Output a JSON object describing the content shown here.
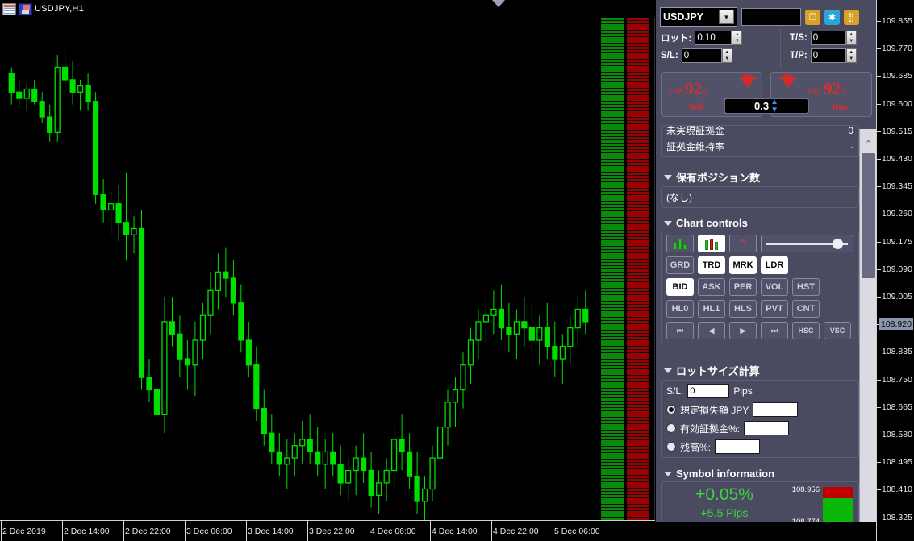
{
  "chart_window": {
    "title": "USDJPY,H1",
    "icons": [
      "window-icon",
      "save-icon"
    ]
  },
  "chart_data": {
    "type": "candlestick",
    "title": "USDJPY,H1",
    "symbol": "USDJPY",
    "timeframe": "H1",
    "xlabel": "",
    "ylabel": "",
    "ylim": [
      108.28,
      109.9
    ],
    "current_price": "108.920",
    "grid": false,
    "legend": null,
    "price_ticks": [
      "109.855",
      "109.770",
      "109.685",
      "109.600",
      "109.515",
      "109.430",
      "109.345",
      "109.260",
      "109.175",
      "109.090",
      "109.005",
      "108.920",
      "108.835",
      "108.750",
      "108.665",
      "108.580",
      "108.495",
      "108.410",
      "108.325"
    ],
    "time_ticks": [
      "2 Dec 2019",
      "2 Dec 14:00",
      "2 Dec 22:00",
      "3 Dec 06:00",
      "3 Dec 14:00",
      "3 Dec 22:00",
      "4 Dec 06:00",
      "4 Dec 14:00",
      "4 Dec 22:00",
      "5 Dec 06:00"
    ],
    "candle_color": "#00e000",
    "background": "#000000",
    "ohlc": [
      [
        109.72,
        109.74,
        109.62,
        109.66
      ],
      [
        109.66,
        109.7,
        109.61,
        109.64
      ],
      [
        109.64,
        109.69,
        109.6,
        109.67
      ],
      [
        109.67,
        109.7,
        109.62,
        109.63
      ],
      [
        109.63,
        109.66,
        109.56,
        109.58
      ],
      [
        109.58,
        109.62,
        109.5,
        109.53
      ],
      [
        109.53,
        109.78,
        109.5,
        109.74
      ],
      [
        109.74,
        109.8,
        109.66,
        109.7
      ],
      [
        109.7,
        109.76,
        109.62,
        109.66
      ],
      [
        109.66,
        109.7,
        109.6,
        109.68
      ],
      [
        109.68,
        109.72,
        109.6,
        109.63
      ],
      [
        109.63,
        109.66,
        109.3,
        109.33
      ],
      [
        109.33,
        109.38,
        109.24,
        109.28
      ],
      [
        109.28,
        109.34,
        109.2,
        109.3
      ],
      [
        109.3,
        109.36,
        109.18,
        109.24
      ],
      [
        109.24,
        109.4,
        109.12,
        109.2
      ],
      [
        109.2,
        109.26,
        109.14,
        109.22
      ],
      [
        109.22,
        109.28,
        108.7,
        108.74
      ],
      [
        108.74,
        108.8,
        108.66,
        108.7
      ],
      [
        108.7,
        108.76,
        108.58,
        108.62
      ],
      [
        108.62,
        109.0,
        108.56,
        108.92
      ],
      [
        108.92,
        109.0,
        108.84,
        108.88
      ],
      [
        108.88,
        108.94,
        108.74,
        108.8
      ],
      [
        108.8,
        108.86,
        108.7,
        108.78
      ],
      [
        108.78,
        108.92,
        108.68,
        108.86
      ],
      [
        108.86,
        108.98,
        108.8,
        108.94
      ],
      [
        108.94,
        109.08,
        108.88,
        109.02
      ],
      [
        109.02,
        109.14,
        108.96,
        109.08
      ],
      [
        109.08,
        109.16,
        109.0,
        109.06
      ],
      [
        109.06,
        109.12,
        108.94,
        108.98
      ],
      [
        108.98,
        109.04,
        108.82,
        108.86
      ],
      [
        108.86,
        108.92,
        108.74,
        108.78
      ],
      [
        108.78,
        108.84,
        108.6,
        108.64
      ],
      [
        108.64,
        108.7,
        108.52,
        108.56
      ],
      [
        108.56,
        108.62,
        108.46,
        108.5
      ],
      [
        108.5,
        108.56,
        108.42,
        108.46
      ],
      [
        108.46,
        108.54,
        108.38,
        108.48
      ],
      [
        108.48,
        108.56,
        108.42,
        108.52
      ],
      [
        108.52,
        108.6,
        108.46,
        108.54
      ],
      [
        108.54,
        108.62,
        108.46,
        108.5
      ],
      [
        108.5,
        108.58,
        108.42,
        108.46
      ],
      [
        108.46,
        108.54,
        108.38,
        108.5
      ],
      [
        108.5,
        108.56,
        108.42,
        108.46
      ],
      [
        108.46,
        108.52,
        108.36,
        108.4
      ],
      [
        108.4,
        108.48,
        108.34,
        108.44
      ],
      [
        108.44,
        108.52,
        108.36,
        108.48
      ],
      [
        108.48,
        108.56,
        108.4,
        108.44
      ],
      [
        108.44,
        108.5,
        108.32,
        108.36
      ],
      [
        108.36,
        108.44,
        108.3,
        108.4
      ],
      [
        108.4,
        108.48,
        108.34,
        108.44
      ],
      [
        108.44,
        108.58,
        108.38,
        108.54
      ],
      [
        108.54,
        108.62,
        108.44,
        108.5
      ],
      [
        108.5,
        108.56,
        108.38,
        108.42
      ],
      [
        108.42,
        108.5,
        108.3,
        108.34
      ],
      [
        108.34,
        108.42,
        108.28,
        108.38
      ],
      [
        108.38,
        108.52,
        108.34,
        108.48
      ],
      [
        108.48,
        108.62,
        108.42,
        108.58
      ],
      [
        108.58,
        108.7,
        108.52,
        108.66
      ],
      [
        108.66,
        108.74,
        108.58,
        108.7
      ],
      [
        108.7,
        108.82,
        108.64,
        108.78
      ],
      [
        108.78,
        108.9,
        108.72,
        108.86
      ],
      [
        108.86,
        108.96,
        108.8,
        108.92
      ],
      [
        108.92,
        109.0,
        108.84,
        108.94
      ],
      [
        108.94,
        109.02,
        108.88,
        108.96
      ],
      [
        108.96,
        109.04,
        108.86,
        108.9
      ],
      [
        108.9,
        108.98,
        108.82,
        108.88
      ],
      [
        108.88,
        108.96,
        108.8,
        108.92
      ],
      [
        108.92,
        109.0,
        108.84,
        108.9
      ],
      [
        108.9,
        108.98,
        108.82,
        108.86
      ],
      [
        108.86,
        108.94,
        108.78,
        108.9
      ],
      [
        108.9,
        108.98,
        108.8,
        108.84
      ],
      [
        108.84,
        108.92,
        108.74,
        108.8
      ],
      [
        108.8,
        108.88,
        108.72,
        108.84
      ],
      [
        108.84,
        108.94,
        108.78,
        108.9
      ],
      [
        108.9,
        109.0,
        108.84,
        108.96
      ],
      [
        108.96,
        109.02,
        108.88,
        108.92
      ]
    ]
  },
  "panel": {
    "symbol": "USDJPY",
    "symbol_blank_value": "",
    "toolbar_icons": [
      "duplicate-icon",
      "gear-icon",
      "grid-icon"
    ],
    "fields": {
      "lot_label": "ロット:",
      "lot_value": "0.10",
      "sl_label": "S/L:",
      "sl_value": "0",
      "ts_label": "T/S:",
      "ts_value": "0",
      "tp_label": "T/P:",
      "tp_value": "0"
    },
    "deal": {
      "sell_label": "Sell",
      "buy_label": "Buy",
      "sell_price_int": "108.",
      "sell_price_big": "92",
      "sell_price_last": "0",
      "buy_price_int": "108.",
      "buy_price_big": "92",
      "buy_price_last": "3",
      "spread": "0.3"
    },
    "margin": {
      "unrealized_label": "未実現証拠金",
      "unrealized_value": "0",
      "maintenance_label": "証拠金維持率",
      "maintenance_value": "-"
    },
    "positions": {
      "header": "保有ポジション数",
      "value": "(なし)"
    },
    "chart_controls": {
      "header": "Chart controls",
      "row1": [
        {
          "name": "candle-mode-icon",
          "label": "",
          "active": false
        },
        {
          "name": "bar-mode-icon",
          "label": "",
          "active": true
        },
        {
          "name": "line-mode-icon",
          "label": "",
          "active": false
        }
      ],
      "row2": [
        {
          "label": "GRD",
          "active": false
        },
        {
          "label": "TRD",
          "active": true
        },
        {
          "label": "MRK",
          "active": true
        },
        {
          "label": "LDR",
          "active": true
        }
      ],
      "row3": [
        {
          "label": "BID",
          "active": true
        },
        {
          "label": "ASK",
          "active": false
        },
        {
          "label": "PER",
          "active": false
        },
        {
          "label": "VOL",
          "active": false
        },
        {
          "label": "HST",
          "active": false
        }
      ],
      "row4": [
        {
          "label": "HL0",
          "active": false
        },
        {
          "label": "HL1",
          "active": false
        },
        {
          "label": "HLS",
          "active": false
        },
        {
          "label": "PVT",
          "active": false
        },
        {
          "label": "CNT",
          "active": false
        }
      ],
      "row5": [
        {
          "label": "⏮",
          "active": false
        },
        {
          "label": "◀",
          "active": false
        },
        {
          "label": "▶",
          "active": false
        },
        {
          "label": "⏭",
          "active": false
        },
        {
          "label": "HSC",
          "active": false
        },
        {
          "label": "VSC",
          "active": false
        }
      ]
    },
    "lot_calc": {
      "header": "ロットサイズ計算",
      "sl_label": "S/L:",
      "sl_value": "0",
      "pips_label": "Pips",
      "options": [
        {
          "label": "想定損失額 JPY",
          "value": "",
          "selected": true
        },
        {
          "label": "有効証拠金%:",
          "value": "",
          "selected": false
        },
        {
          "label": "残高%:",
          "value": "",
          "selected": false
        }
      ]
    },
    "symbol_info": {
      "header": "Symbol information",
      "percent": "+0.05%",
      "pips": "+5.5 Pips",
      "high": "108.956",
      "low": "108.774"
    }
  }
}
